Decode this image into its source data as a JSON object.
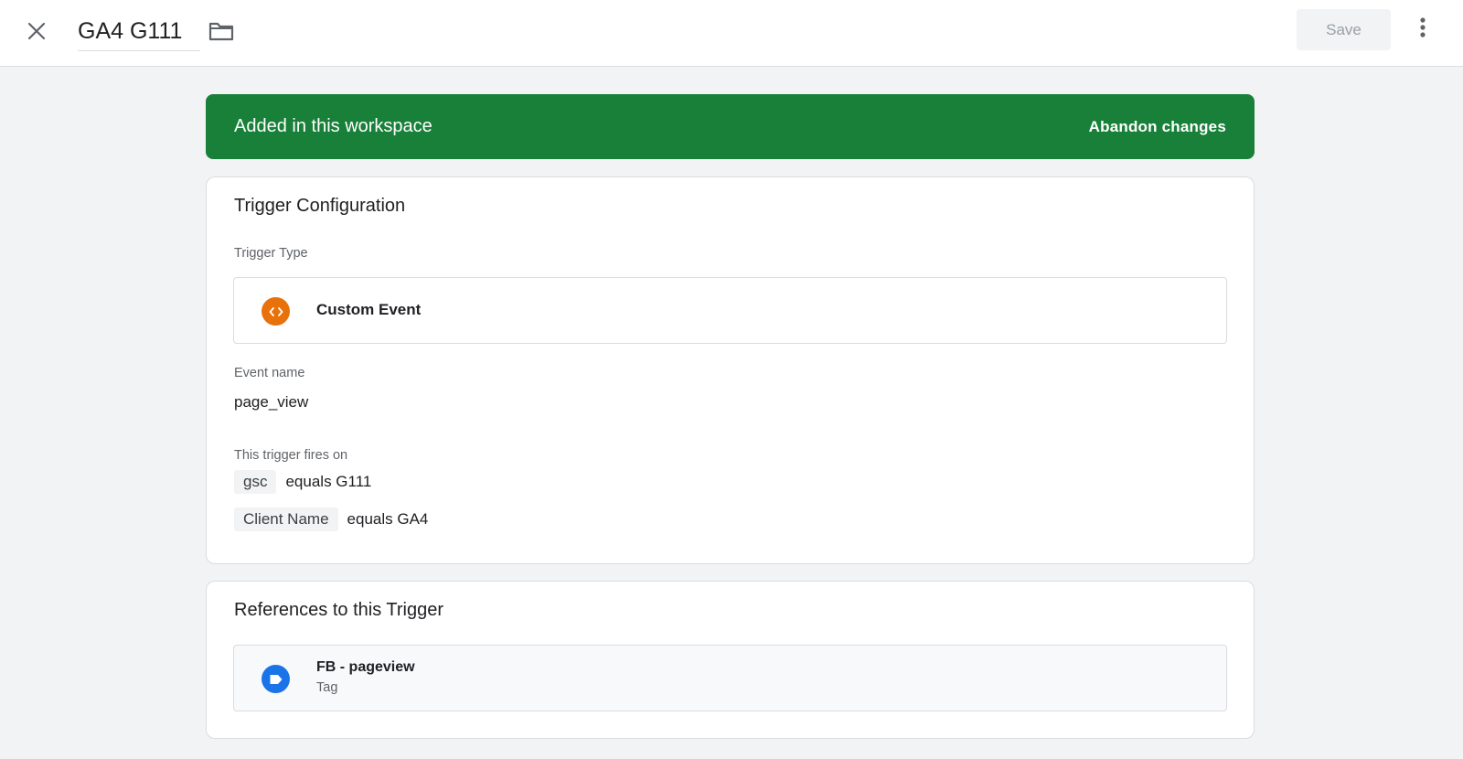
{
  "header": {
    "title": "GA4 G111",
    "save_label": "Save",
    "icons": {
      "close": "close-icon",
      "folder": "folder-icon",
      "more": "more-vert-icon"
    }
  },
  "banner": {
    "text": "Added in this workspace",
    "action_label": "Abandon changes",
    "color": "#188038"
  },
  "trigger_config": {
    "title": "Trigger Configuration",
    "type_label": "Trigger Type",
    "type_value": "Custom Event",
    "type_icon": "custom-event-code-icon",
    "type_icon_color": "#e8710a",
    "event_name_label": "Event name",
    "event_name_value": "page_view",
    "fires_on_label": "This trigger fires on",
    "conditions": [
      {
        "variable": "gsc",
        "expression": "equals G111"
      },
      {
        "variable": "Client Name",
        "expression": "equals GA4"
      }
    ]
  },
  "references": {
    "title": "References to this Trigger",
    "items": [
      {
        "name": "FB - pageview",
        "type": "Tag",
        "icon": "tag-icon",
        "icon_color": "#1a73e8"
      }
    ]
  }
}
